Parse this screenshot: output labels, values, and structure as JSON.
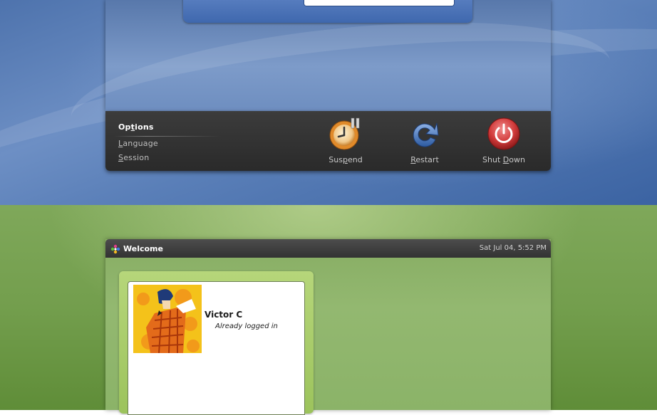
{
  "options_menu": {
    "items": [
      {
        "mnemonic_before": "Op",
        "mnemonic": "t",
        "mnemonic_after": "ions"
      },
      {
        "mnemonic_before": "",
        "mnemonic": "L",
        "mnemonic_after": "anguage"
      },
      {
        "mnemonic_before": "",
        "mnemonic": "S",
        "mnemonic_after": "ession"
      }
    ]
  },
  "actions": {
    "suspend": {
      "before": "Sus",
      "mnemonic": "p",
      "after": "end",
      "icon": "suspend-clock-icon"
    },
    "restart": {
      "before": "",
      "mnemonic": "R",
      "after": "estart",
      "icon": "restart-arrow-icon"
    },
    "shutdown": {
      "before": "Shut ",
      "mnemonic": "D",
      "after": "own",
      "icon": "power-icon"
    }
  },
  "panel": {
    "title": "Welcome",
    "clock": "Sat Jul 04,  5:52 PM",
    "logo": "distro-logo-icon"
  },
  "users": [
    {
      "name": "Victor C",
      "status": "Already logged in",
      "avatar": "user-avatar"
    }
  ],
  "colors": {
    "top_desktop": "#5a7fb8",
    "bottom_desktop": "#739e4d",
    "shutdown_red": "#d03a3a",
    "restart_blue": "#3f6fb8",
    "suspend_orange": "#e08a2a"
  }
}
